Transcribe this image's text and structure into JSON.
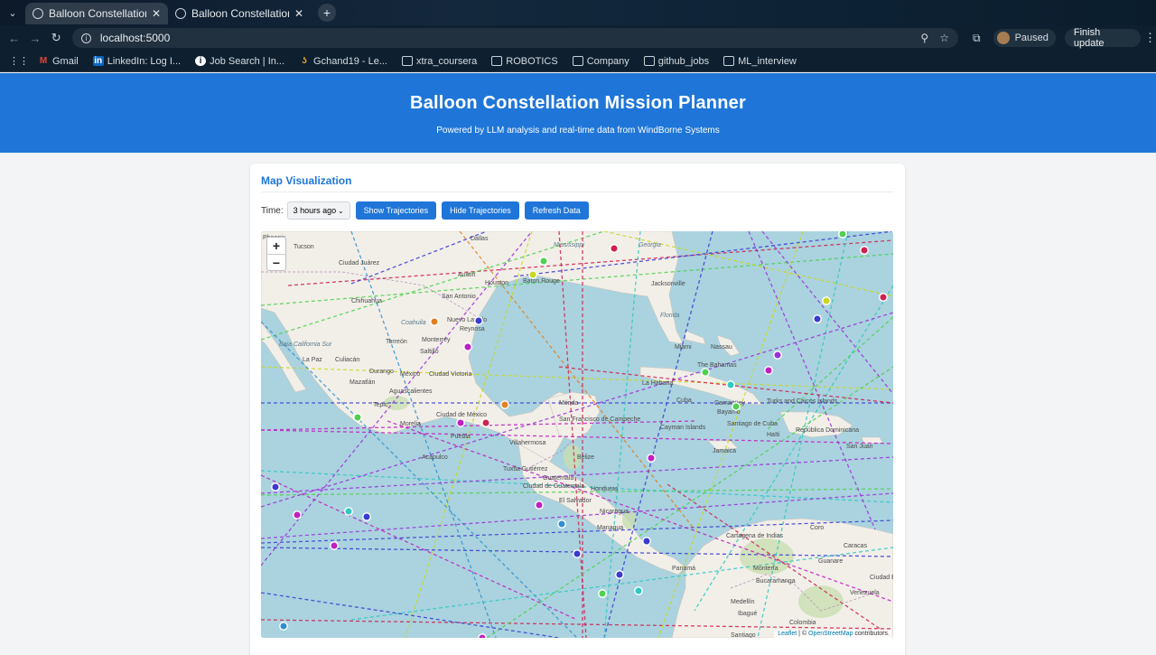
{
  "browser": {
    "tabs": [
      {
        "title": "Balloon Constellation Mi"
      },
      {
        "title": "Balloon Constellation Mi"
      }
    ],
    "url": "localhost:5000",
    "profile_status": "Paused",
    "update_label": "Finish update",
    "bookmarks": [
      {
        "label": "Gmail",
        "icon": "gmail-icon"
      },
      {
        "label": "LinkedIn: Log I...",
        "icon": "linkedin-icon"
      },
      {
        "label": "Job Search | In...",
        "icon": "info-icon"
      },
      {
        "label": "Gchand19 - Le...",
        "icon": "leetcode-icon"
      },
      {
        "label": "xtra_coursera",
        "icon": "folder-icon"
      },
      {
        "label": "ROBOTICS",
        "icon": "folder-icon"
      },
      {
        "label": "Company",
        "icon": "folder-icon"
      },
      {
        "label": "github_jobs",
        "icon": "folder-icon"
      },
      {
        "label": "ML_interview",
        "icon": "folder-icon"
      }
    ]
  },
  "header": {
    "title": "Balloon Constellation Mission Planner",
    "subtitle": "Powered by LLM analysis and real-time data from WindBorne Systems",
    "color": "#1f76d8"
  },
  "map_section": {
    "title": "Map Visualization",
    "time_label": "Time:",
    "time_selected": "3 hours ago",
    "buttons": {
      "show": "Show Trajectories",
      "hide": "Hide Trajectories",
      "refresh": "Refresh Data"
    },
    "zoom_in": "+",
    "zoom_out": "−",
    "attribution": {
      "leaflet": "Leaflet",
      "sep": " | © ",
      "osm": "OpenStreetMap",
      "tail": " contributors"
    },
    "labels": {
      "phoenix": "Phoenix",
      "tucson": "Tucson",
      "dallas": "Dallas",
      "juarez": "Ciudad Juárez",
      "austin": "Austin",
      "houston": "Houston",
      "baton_rouge": "Baton Rouge",
      "mississippi": "Mississippi",
      "georgia": "Georgia",
      "jacksonville": "Jacksonville",
      "san_antonio": "San Antonio",
      "chihuahua": "Chihuahua",
      "florida": "Florida",
      "nuevo_laredo": "Nuevo Laredo",
      "reynosa": "Reynosa",
      "coahuila": "Coahuila",
      "monterrey": "Monterrey",
      "torreon": "Torreón",
      "saltillo": "Saltillo",
      "baja": "Baja California Sur",
      "la_paz": "La Paz",
      "culiacan": "Culiacán",
      "mazatlan": "Mazatlán",
      "durango": "Durango",
      "mexico": "México",
      "ciudad_victoria": "Ciudad Victoria",
      "miami": "Miami",
      "nassau": "Nassau",
      "bahamas": "The Bahamas",
      "habana": "La Habana",
      "cuba": "Cuba",
      "camaguey": "Camagüey",
      "turks": "Turks and Caicos Islands",
      "aguascalientes": "Aguascalientes",
      "merida": "Mérida",
      "tepic": "Tepic",
      "morelia": "Morelia",
      "cdmx": "Ciudad de México",
      "puebla": "Puebla",
      "campeche": "San Francisco de Campeche",
      "bayamo": "Bayamo",
      "santiago_cuba": "Santiago de Cuba",
      "haiti": "Haïti",
      "dominicana": "República Dominicana",
      "san_juan": "San Juan",
      "cayman": "Cayman Islands",
      "villahermosa": "Villahermosa",
      "belize": "Belize",
      "acapulco": "Acapulco",
      "tuxtla": "Tuxtla Gutiérrez",
      "jamaica": "Jamaica",
      "guatemala": "Guatemala",
      "ciudad_guatemala": "Ciudad de Guatemala",
      "honduras": "Honduras",
      "salvador": "El Salvador",
      "nicaragua": "Nicaragua",
      "managua": "Managua",
      "coro": "Coro",
      "cartagena": "Cartagena de Indias",
      "caracas": "Caracas",
      "panama": "Panamá",
      "monteria": "Montería",
      "guanare": "Guanare",
      "ciudad_bolivar": "Ciudad B",
      "bucaramanga": "Bucaramanga",
      "venezuela": "Venezuela",
      "medellin": "Medellín",
      "ibague": "Ibagué",
      "colombia": "Colombia",
      "santiago_cali": "Santiago"
    },
    "balloon_colors": [
      "#3a3ad0",
      "#c020c0",
      "#9a30d8",
      "#30c8c0",
      "#50d050",
      "#d02050",
      "#e08020",
      "#c8d820",
      "#3090d0"
    ]
  }
}
